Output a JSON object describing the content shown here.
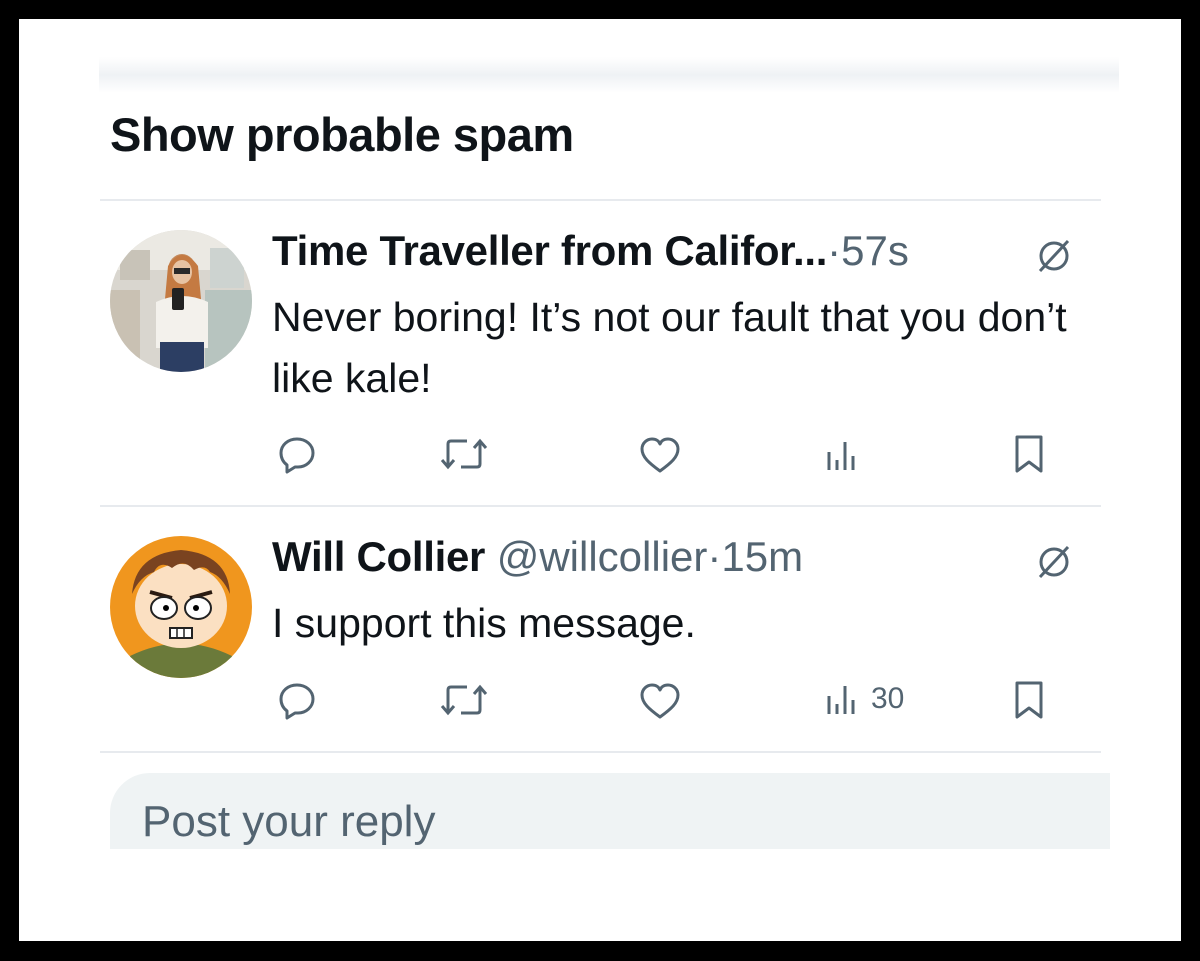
{
  "section": {
    "title": "Show probable spam"
  },
  "replies": [
    {
      "display_name": "Time Traveller from Califor...",
      "handle": "",
      "separator": "·",
      "time": "57s",
      "text": "Never boring! It’s not our fault that you don’t like kale!",
      "views": ""
    },
    {
      "display_name": "Will Collier",
      "handle": "@willcollier",
      "separator": "·",
      "time": "15m",
      "text": "I support this message.",
      "views": "30"
    }
  ],
  "composer": {
    "placeholder": "Post your reply"
  },
  "colors": {
    "text": "#0f1419",
    "secondary": "#536471",
    "divider": "#e7eaee",
    "input_bg": "#eff3f4"
  },
  "icons": [
    "reply-icon",
    "repost-icon",
    "like-icon",
    "views-icon",
    "bookmark-icon",
    "spam-indicator-icon"
  ]
}
